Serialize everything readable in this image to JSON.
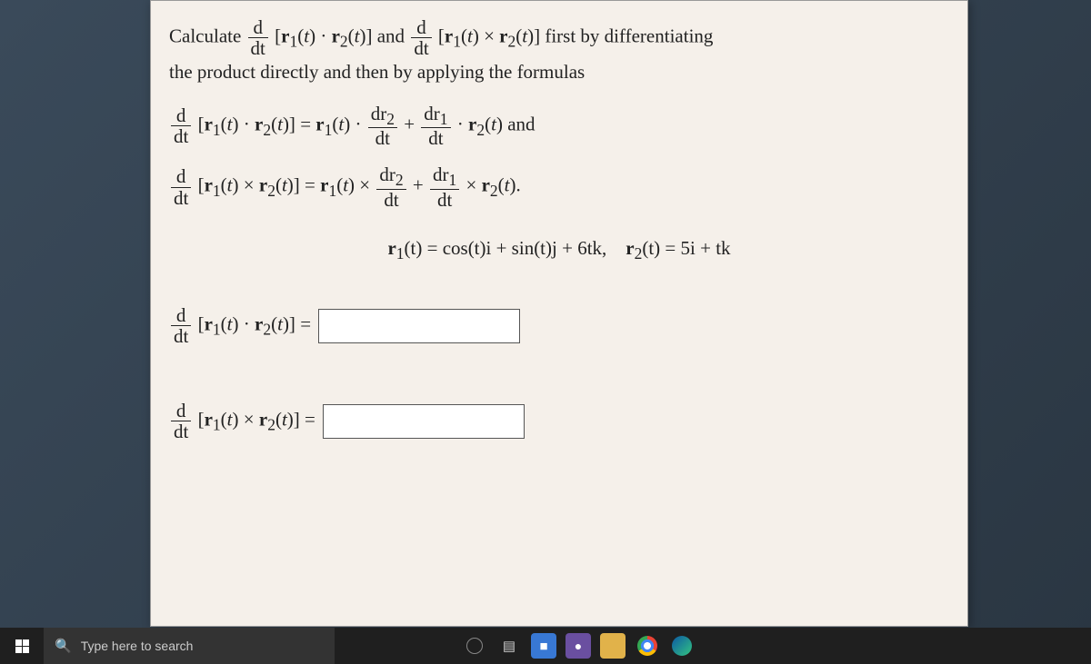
{
  "problem": {
    "intro_a": "Calculate ",
    "intro_b": " and ",
    "intro_c": " first by differentiating",
    "line2": "the product directly and then by applying the formulas",
    "and_word": " and",
    "period": ".",
    "given_sep": ",   ",
    "r1_def_lhs": "r",
    "r1_def": "(t) = cos(t)i + sin(t)j + 6tk",
    "r2_def_lhs": "r",
    "r2_def": "(t) = 5i + tk",
    "answer1_lhs_eq": " =",
    "answer2_lhs_eq": " =",
    "sub1": "1",
    "sub2": "2",
    "d": "d",
    "dt": "dt",
    "dr1": "dr",
    "dr2": "dr",
    "times": "×",
    "dot": "·",
    "plus": "+",
    "eq": "="
  },
  "taskbar": {
    "search_placeholder": "Type here to search"
  }
}
